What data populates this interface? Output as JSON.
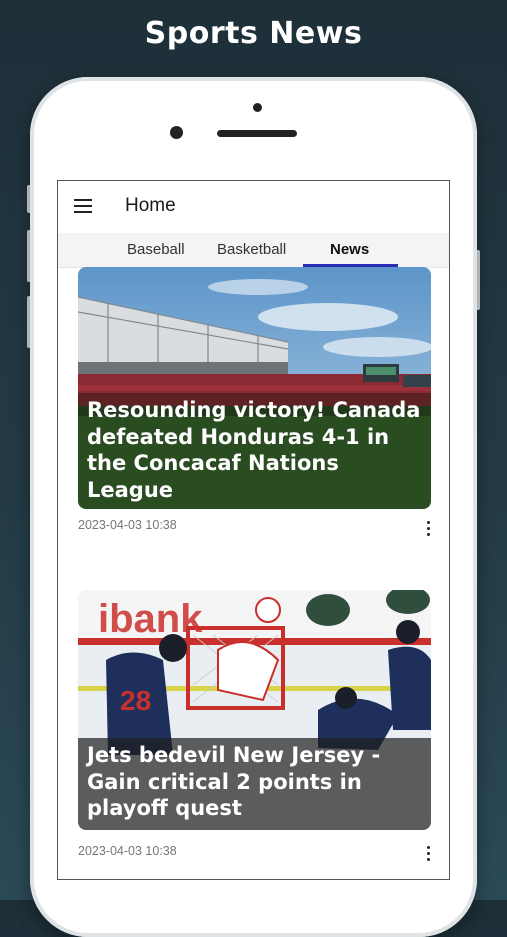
{
  "promo": {
    "title": "Sports News"
  },
  "appbar": {
    "title": "Home",
    "menu_icon": "hamburger-menu-icon"
  },
  "tabs": [
    {
      "label": "Baseball",
      "active": false
    },
    {
      "label": "Basketball",
      "active": false
    },
    {
      "label": "News",
      "active": true
    }
  ],
  "articles": [
    {
      "headline": "Resounding victory! Canada defeated Honduras 4-1 in the Concacaf Nations League",
      "timestamp": "2023-04-03 10:38",
      "image": "soccer-stadium-photo"
    },
    {
      "headline": "Jets bedevil New Jersey - Gain critical 2 points in playoff quest",
      "timestamp": "2023-04-03 10:38",
      "image": "hockey-game-photo"
    }
  ],
  "colors": {
    "tab_indicator": "#2b2fb3",
    "background": "#1e2f38"
  }
}
